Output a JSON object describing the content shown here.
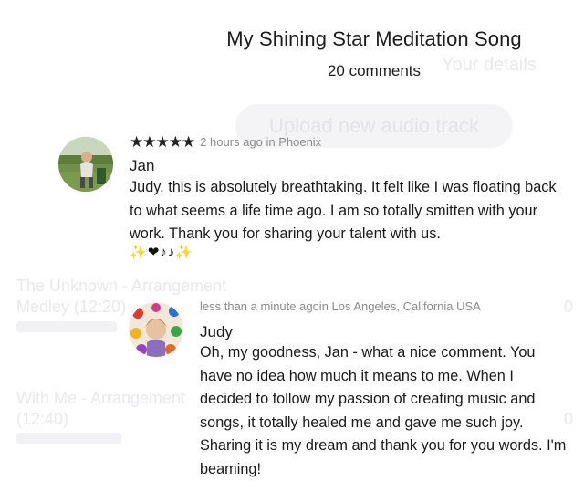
{
  "colors": {
    "text": "#1a1a1a",
    "meta": "#8c8c8c",
    "faded_bg": "#e9e9ec"
  },
  "background": {
    "subtitle_fragment": "Your details",
    "upload_button_label": "Upload new audio track",
    "track_1_title": "The Unknown - Arrangement",
    "track_1_line2": "Medley (12:20)",
    "track_2_title": "With Me - Arrangement",
    "track_2_duration": "(12:40)"
  },
  "header": {
    "title": "My Shining Star Meditation Song",
    "comment_count": "20 comments"
  },
  "comments": [
    {
      "author": "Jan",
      "rating_stars": "★★★★★",
      "rating": 5,
      "meta": "2 hours ago in Phoenix",
      "text": "Judy, this is absolutely breathtaking. It felt like I was floating back to what seems a life time ago. I am so totally smitten with your work. Thank you for sharing your talent with us.",
      "emoji_icons": [
        "sparkles-icon",
        "heart-icon",
        "music-notes-icon",
        "sparkles-icon"
      ]
    },
    {
      "author": "Judy",
      "meta": "less than a minute agoin Los Angeles, California USA",
      "text": "Oh, my goodness, Jan - what a nice comment. You have no idea how much it means to me. When I decided to follow my passion of creating music and songs, it totally healed me and gave me such joy. Sharing it is my dream and thank you for you words. I'm beaming!"
    }
  ]
}
